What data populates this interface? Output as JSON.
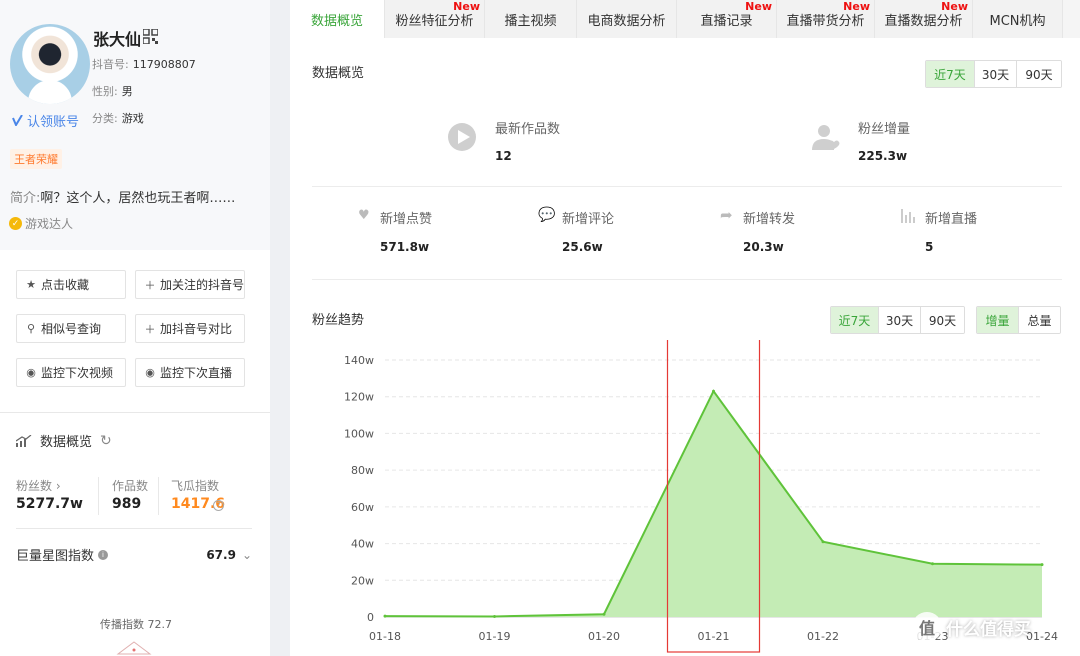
{
  "profile": {
    "name": "张大仙",
    "douyin_id_label": "抖音号:",
    "douyin_id": "117908807",
    "gender_label": "性别:",
    "gender": "男",
    "category_label": "分类:",
    "category": "游戏",
    "claim_label": "认领账号",
    "tag": "王者荣耀",
    "intro_label": "简介:",
    "intro": "啊？这个人，居然也玩王者啊……",
    "expert": "游戏达人"
  },
  "actions": {
    "favorite": "点击收藏",
    "follow_add": "加关注的抖音号",
    "similar": "相似号查询",
    "compare": "加抖音号对比",
    "monitor_video": "监控下次视频",
    "monitor_live": "监控下次直播"
  },
  "overview_side": {
    "title": "数据概览",
    "fans_label": "粉丝数",
    "fans": "5277.7w",
    "works_label": "作品数",
    "works": "989",
    "feigua_label": "飞瓜指数",
    "feigua": "1417.6",
    "star_label": "巨量星图指数",
    "star_value": "67.9",
    "spread_label": "传播指数 72.7"
  },
  "tabs": [
    {
      "label": "数据概览",
      "new": ""
    },
    {
      "label": "粉丝特征分析",
      "new": "New"
    },
    {
      "label": "播主视频",
      "new": ""
    },
    {
      "label": "电商数据分析",
      "new": ""
    },
    {
      "label": "直播记录",
      "new": "New"
    },
    {
      "label": "直播带货分析",
      "new": "New"
    },
    {
      "label": "直播数据分析",
      "new": "New"
    },
    {
      "label": "MCN机构",
      "new": ""
    }
  ],
  "overview": {
    "title": "数据概览",
    "ranges": [
      "近7天",
      "30天",
      "90天"
    ],
    "latest_works_label": "最新作品数",
    "latest_works": "12",
    "fans_growth_label": "粉丝增量",
    "fans_growth": "225.3w",
    "likes_label": "新增点赞",
    "likes": "571.8w",
    "comments_label": "新增评论",
    "comments": "25.6w",
    "shares_label": "新增转发",
    "shares": "20.3w",
    "lives_label": "新增直播",
    "lives": "5"
  },
  "trend": {
    "title": "粉丝趋势",
    "ranges": [
      "近7天",
      "30天",
      "90天"
    ],
    "modes": [
      "增量",
      "总量"
    ]
  },
  "chart_data": {
    "type": "area",
    "title": "粉丝趋势",
    "categories": [
      "01-18",
      "01-19",
      "01-20",
      "01-21",
      "01-22",
      "01-23",
      "01-24"
    ],
    "series": [
      {
        "values": [
          0.5,
          0.3,
          1.5,
          123,
          41,
          29,
          28.5
        ]
      }
    ],
    "yticks": [
      "0",
      "20w",
      "40w",
      "60w",
      "80w",
      "100w",
      "120w",
      "140w"
    ],
    "ylim": [
      0,
      140
    ],
    "grid": true,
    "color": "#5fc33a",
    "fill": "#c4ecb5",
    "highlight_box_color": "#e53935"
  },
  "watermark": {
    "text": "什么值得买",
    "icon": "值"
  }
}
